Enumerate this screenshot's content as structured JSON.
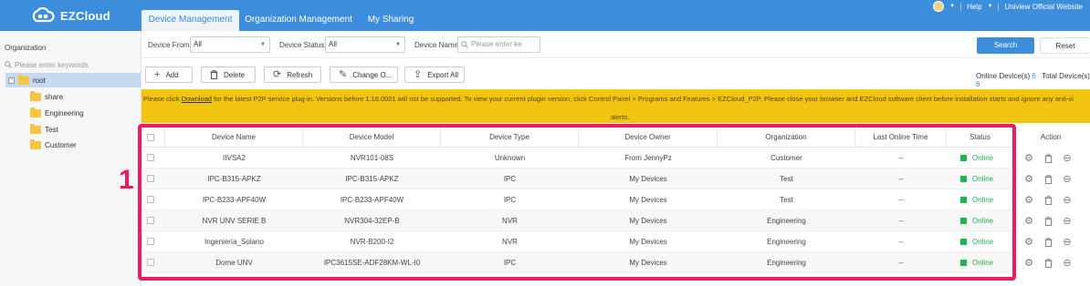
{
  "app": {
    "title": "EZCloud"
  },
  "tabs": [
    {
      "label": "Device Management",
      "active": true
    },
    {
      "label": "Organization Management",
      "active": false
    },
    {
      "label": "My Sharing",
      "active": false
    }
  ],
  "topright": {
    "help": "Help",
    "website": "Uniview Official Website"
  },
  "sidebar": {
    "title": "Organization",
    "search_placeholder": "Please enter keywords",
    "tree": [
      {
        "label": "root",
        "selected": true,
        "shared": false
      },
      {
        "label": "share",
        "selected": false,
        "shared": true
      },
      {
        "label": "Engineering",
        "selected": false,
        "shared": false
      },
      {
        "label": "Test",
        "selected": false,
        "shared": false
      },
      {
        "label": "Customer",
        "selected": false,
        "shared": false
      }
    ]
  },
  "filters": {
    "device_from_label": "Device From:",
    "device_from_value": "All",
    "device_status_label": "Device Status:",
    "device_status_value": "All",
    "device_name_label": "Device Name:",
    "device_name_placeholder": "Please enter ke",
    "search_label": "Search",
    "reset_label": "Reset"
  },
  "toolbar": {
    "add": "Add",
    "delete": "Delete",
    "refresh": "Refresh",
    "change": "Change O...",
    "export": "Export All",
    "online_label": "Online Device(s)",
    "online_count": "6",
    "total_label": "Total Device(s)",
    "total_count": "6"
  },
  "banner": {
    "prefix": "Please click ",
    "link": "Download",
    "line1_rest": " for the latest P2P service plug-in. Versions before 1.16.0001 will not be supported. To view your current plugin version, click Control Panel > Programs and Features > EZCloud_P2P. Please close your browser and EZCloud software client before installation starts and ignore any anti-vi",
    "line2": "alerts."
  },
  "table": {
    "columns": [
      "Device Name",
      "Device Model",
      "Device Type",
      "Device Owner",
      "Organization",
      "Last Online Time",
      "Status"
    ],
    "action_header": "Action",
    "rows": [
      {
        "name": "IIVSA2",
        "model": "NVR101-08S",
        "type": "Unknown",
        "owner": "From JennyPz",
        "org": "Customer",
        "last": "--",
        "status": "Online"
      },
      {
        "name": "IPC-B315-APKZ",
        "model": "IPC-B315-APKZ",
        "type": "IPC",
        "owner": "My Devices",
        "org": "Test",
        "last": "--",
        "status": "Online"
      },
      {
        "name": "IPC-B233-APF40W",
        "model": "IPC-B233-APF40W",
        "type": "IPC",
        "owner": "My Devices",
        "org": "Test",
        "last": "--",
        "status": "Online"
      },
      {
        "name": "NVR UNV SERIE B",
        "model": "NVR304-32EP-B",
        "type": "NVR",
        "owner": "My Devices",
        "org": "Engineering",
        "last": "--",
        "status": "Online"
      },
      {
        "name": "Ingeniería_Solano",
        "model": "NVR-B200-I2",
        "type": "NVR",
        "owner": "My Devices",
        "org": "Engineering",
        "last": "--",
        "status": "Online"
      },
      {
        "name": "Dome UNV",
        "model": "IPC3615SE-ADF28KM-WL-I0",
        "type": "IPC",
        "owner": "My Devices",
        "org": "Engineering",
        "last": "--",
        "status": "Online"
      }
    ]
  },
  "annotation": {
    "callout_number": "1"
  },
  "colors": {
    "brand": "#3c8ddc",
    "online": "#23b24b",
    "banner": "#f1c50f",
    "highlight": "#ec1c63"
  }
}
